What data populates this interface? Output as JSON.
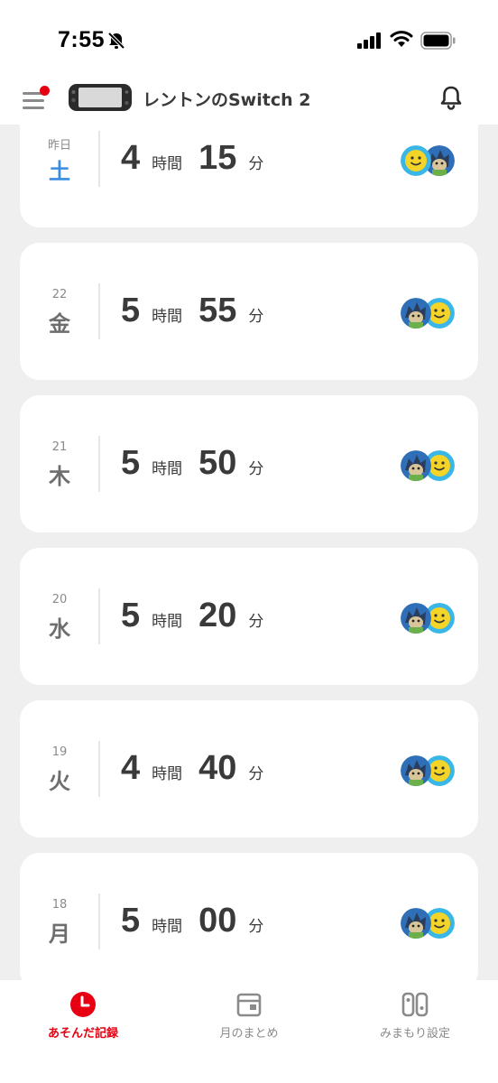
{
  "status_bar": {
    "time": "7:55"
  },
  "header": {
    "device_name": "レントンのSwitch 2"
  },
  "days": [
    {
      "date": "昨日",
      "weekday": "土",
      "hours": "4",
      "hours_unit": "時間",
      "minutes": "15",
      "minutes_unit": "分",
      "is_saturday": true
    },
    {
      "date": "22",
      "weekday": "金",
      "hours": "5",
      "hours_unit": "時間",
      "minutes": "55",
      "minutes_unit": "分"
    },
    {
      "date": "21",
      "weekday": "木",
      "hours": "5",
      "hours_unit": "時間",
      "minutes": "50",
      "minutes_unit": "分"
    },
    {
      "date": "20",
      "weekday": "水",
      "hours": "5",
      "hours_unit": "時間",
      "minutes": "20",
      "minutes_unit": "分"
    },
    {
      "date": "19",
      "weekday": "火",
      "hours": "4",
      "hours_unit": "時間",
      "minutes": "40",
      "minutes_unit": "分"
    },
    {
      "date": "18",
      "weekday": "月",
      "hours": "5",
      "hours_unit": "時間",
      "minutes": "00",
      "minutes_unit": "分"
    }
  ],
  "bottom_nav": {
    "items": [
      {
        "label": "あそんだ記録",
        "icon": "clock-icon",
        "active": true
      },
      {
        "label": "月のまとめ",
        "icon": "calendar-icon",
        "active": false
      },
      {
        "label": "みまもり設定",
        "icon": "switch-console-icon",
        "active": false
      }
    ]
  },
  "colors": {
    "accent": "#e60012",
    "saturday": "#3a8de0",
    "background": "#efefef"
  }
}
